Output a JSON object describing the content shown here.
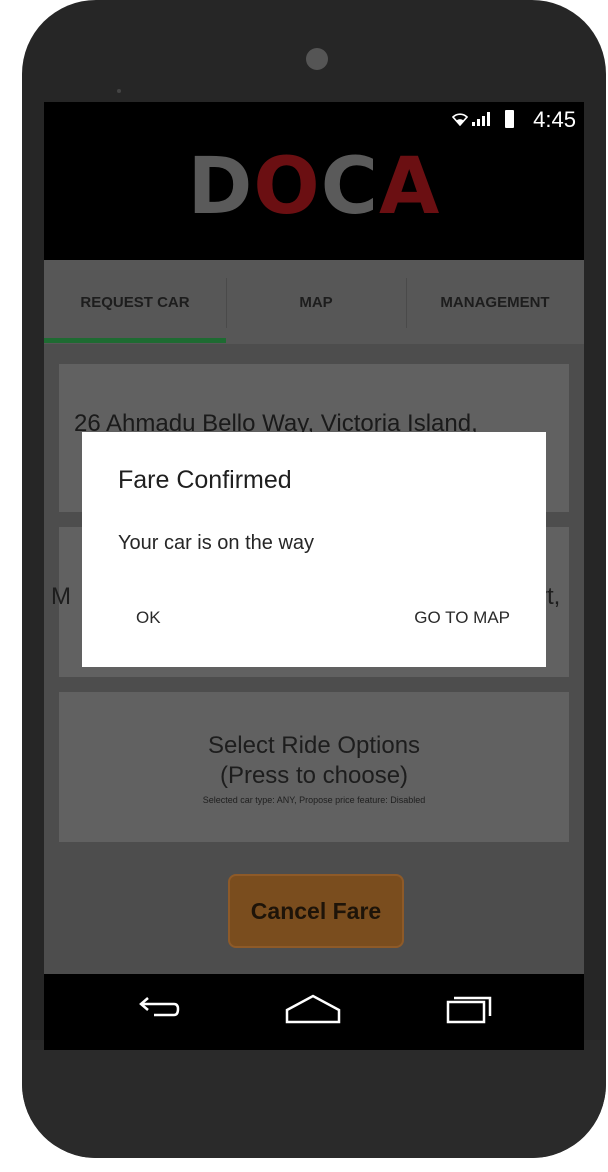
{
  "status_bar": {
    "time": "4:45",
    "icons": [
      "wifi-icon",
      "signal-icon",
      "battery-icon"
    ]
  },
  "app": {
    "brand_letters": [
      "D",
      "O",
      "C",
      "A"
    ],
    "brand_colors": [
      "#5a5a5a",
      "#6b0f12",
      "#5a5a5a",
      "#6b0f12"
    ]
  },
  "tabs": [
    {
      "label": "REQUEST CAR",
      "selected": true
    },
    {
      "label": "MAP",
      "selected": false
    },
    {
      "label": "MANAGEMENT",
      "selected": false
    }
  ],
  "form": {
    "pickup_address": "26 Ahmadu Bello Way, Victoria Island,",
    "destination_start": "M",
    "destination_end": "rt,",
    "ride_options_title": "Select Ride Options",
    "ride_options_subtitle": "(Press to choose)",
    "ride_options_details": "Selected car type: ANY, Propose price feature: Disabled",
    "cancel_button": "Cancel Fare"
  },
  "dialog": {
    "title": "Fare Confirmed",
    "message": "Your car is on the way",
    "ok_button": "OK",
    "map_button": "GO TO MAP"
  },
  "nav": {
    "icons": [
      "back-icon",
      "home-icon",
      "recents-icon"
    ]
  },
  "colors": {
    "accent_green": "#1e6b32",
    "cancel_button": "#7a4d1e",
    "brand_red": "#6b0f12"
  }
}
